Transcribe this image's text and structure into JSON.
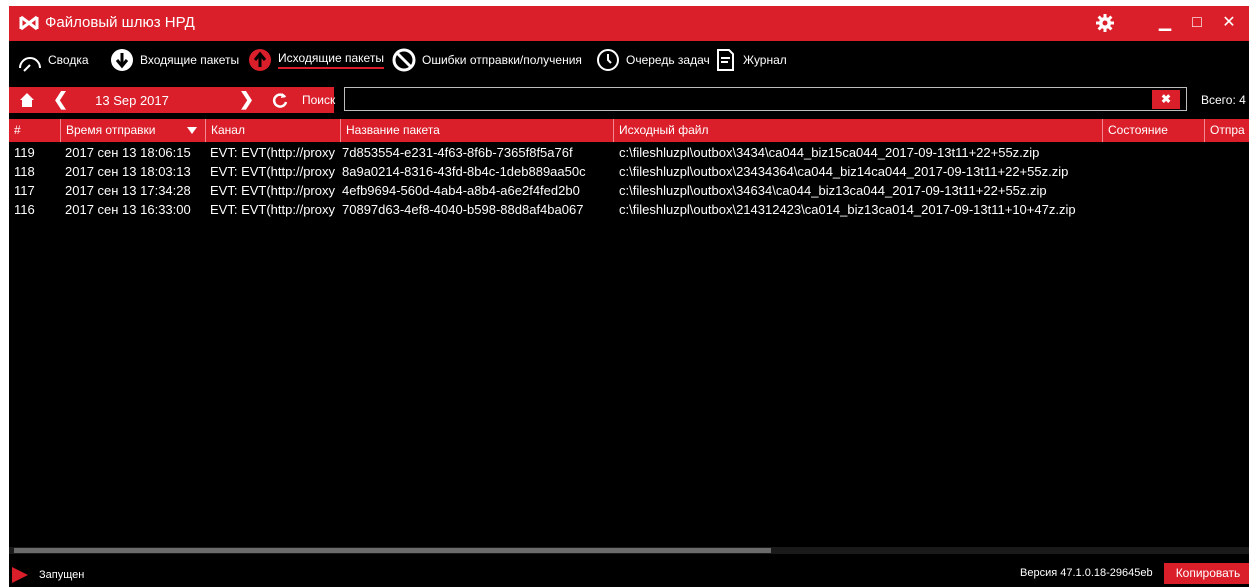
{
  "app": {
    "title": "Файловый шлюз НРД"
  },
  "tabs": [
    {
      "label": "Сводка",
      "icon": "gauge-icon"
    },
    {
      "label": "Входящие пакеты",
      "icon": "arrow-down-circle-icon"
    },
    {
      "label": "Исходящие пакеты",
      "icon": "arrow-up-circle-icon",
      "active": true
    },
    {
      "label": "Ошибки отправки/получения",
      "icon": "prohibited-icon"
    },
    {
      "label": "Очередь задач",
      "icon": "clock-icon"
    },
    {
      "label": "Журнал",
      "icon": "document-icon"
    }
  ],
  "toolbar": {
    "date": "13 Sep 2017",
    "search_label": "Поиск",
    "search_value": "",
    "clear_symbol": "✖",
    "total": "Всего: 4"
  },
  "table": {
    "columns": [
      "#",
      "Время отправки",
      "Канал",
      "Название пакета",
      "Исходный файл",
      "Состояние",
      "Отпра"
    ],
    "rows": [
      [
        "119",
        "2017 сен 13 18:06:15",
        "EVT: EVT(http://proxy",
        "7d853554-e231-4f63-8f6b-7365f8f5a76f",
        "c:\\fileshluzpl\\outbox\\3434\\ca044_biz15ca044_2017-09-13t11+22+55z.zip",
        "",
        ""
      ],
      [
        "118",
        "2017 сен 13 18:03:13",
        "EVT: EVT(http://proxy",
        "8a9a0214-8316-43fd-8b4c-1deb889aa50c",
        "c:\\fileshluzpl\\outbox\\23434364\\ca044_biz14ca044_2017-09-13t11+22+55z.zip",
        "",
        ""
      ],
      [
        "117",
        "2017 сен 13 17:34:28",
        "EVT: EVT(http://proxy",
        "4efb9694-560d-4ab4-a8b4-a6e2f4fed2b0",
        "c:\\fileshluzpl\\outbox\\34634\\ca044_biz13ca044_2017-09-13t11+22+55z.zip",
        "",
        ""
      ],
      [
        "116",
        "2017 сен 13 16:33:00",
        "EVT: EVT(http://proxy",
        "70897d63-4ef8-4040-b598-88d8af4ba067",
        "c:\\fileshluzpl\\outbox\\214312423\\ca014_biz13ca014_2017-09-13t11+10+47z.zip",
        "",
        ""
      ]
    ]
  },
  "statusbar": {
    "status": "Запущен",
    "version": "Версия 47.1.0.18-29645eb",
    "copy_label": "Копировать"
  },
  "colors": {
    "accent": "#da1f2b",
    "background": "#000000",
    "text": "#ffffff"
  }
}
